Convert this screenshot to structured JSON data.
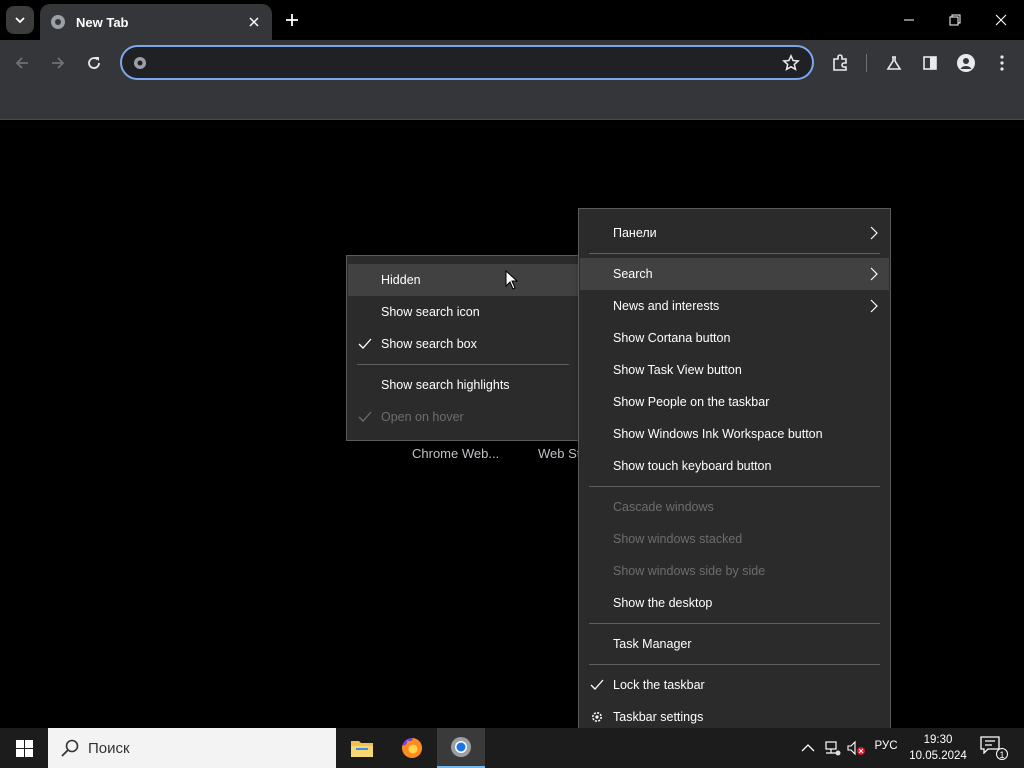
{
  "browser": {
    "tab_title": "New Tab",
    "omnibox_value": "",
    "omnibox_placeholder": ""
  },
  "page": {
    "shortcuts": [
      "Chrome Web...",
      "Web St"
    ]
  },
  "search_submenu": {
    "items": [
      {
        "label": "Hidden",
        "checked": false,
        "disabled": false,
        "hover": true
      },
      {
        "label": "Show search icon",
        "checked": false,
        "disabled": false
      },
      {
        "label": "Show search box",
        "checked": true,
        "disabled": false
      },
      {
        "label": "Show search highlights",
        "checked": false,
        "disabled": false
      },
      {
        "label": "Open on hover",
        "checked": true,
        "disabled": true
      }
    ]
  },
  "taskbar_menu": {
    "items": [
      {
        "label": "Панели",
        "submenu": true
      },
      {
        "label": "Search",
        "submenu": true
      },
      {
        "label": "News and interests",
        "submenu": true
      },
      {
        "label": "Show Cortana button"
      },
      {
        "label": "Show Task View button"
      },
      {
        "label": "Show People on the taskbar"
      },
      {
        "label": "Show Windows Ink Workspace button"
      },
      {
        "label": "Show touch keyboard button"
      },
      {
        "label": "Cascade windows",
        "disabled": true
      },
      {
        "label": "Show windows stacked",
        "disabled": true
      },
      {
        "label": "Show windows side by side",
        "disabled": true
      },
      {
        "label": "Show the desktop"
      },
      {
        "label": "Task Manager"
      },
      {
        "label": "Lock the taskbar",
        "checked": true
      },
      {
        "label": "Taskbar settings",
        "icon": "gear-icon"
      }
    ]
  },
  "taskbar": {
    "search_text": "Поиск",
    "language": "РУС",
    "time": "19:30",
    "date": "10.05.2024",
    "notification_count": "1"
  },
  "colors": {
    "accent": "#7ca7ef",
    "menu_bg": "#2b2b2b",
    "taskbar_bg": "#1c1c1c"
  }
}
